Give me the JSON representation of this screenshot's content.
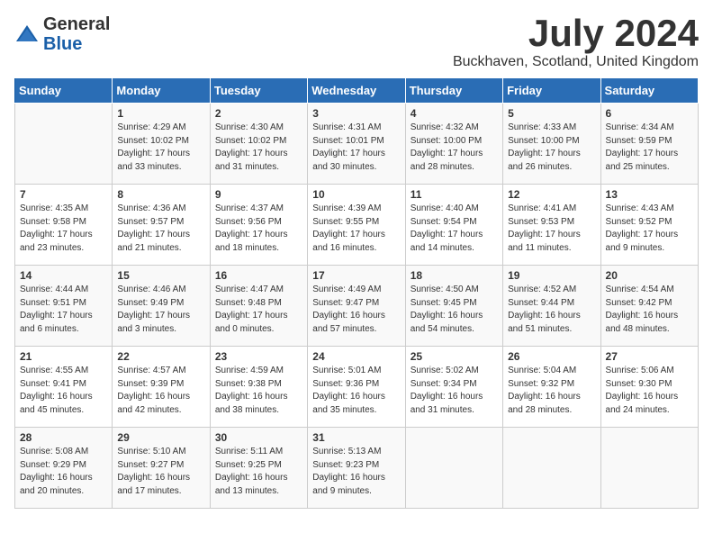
{
  "header": {
    "logo_line1": "General",
    "logo_line2": "Blue",
    "month": "July 2024",
    "location": "Buckhaven, Scotland, United Kingdom"
  },
  "days_of_week": [
    "Sunday",
    "Monday",
    "Tuesday",
    "Wednesday",
    "Thursday",
    "Friday",
    "Saturday"
  ],
  "weeks": [
    [
      {
        "day": "",
        "content": ""
      },
      {
        "day": "1",
        "content": "Sunrise: 4:29 AM\nSunset: 10:02 PM\nDaylight: 17 hours\nand 33 minutes."
      },
      {
        "day": "2",
        "content": "Sunrise: 4:30 AM\nSunset: 10:02 PM\nDaylight: 17 hours\nand 31 minutes."
      },
      {
        "day": "3",
        "content": "Sunrise: 4:31 AM\nSunset: 10:01 PM\nDaylight: 17 hours\nand 30 minutes."
      },
      {
        "day": "4",
        "content": "Sunrise: 4:32 AM\nSunset: 10:00 PM\nDaylight: 17 hours\nand 28 minutes."
      },
      {
        "day": "5",
        "content": "Sunrise: 4:33 AM\nSunset: 10:00 PM\nDaylight: 17 hours\nand 26 minutes."
      },
      {
        "day": "6",
        "content": "Sunrise: 4:34 AM\nSunset: 9:59 PM\nDaylight: 17 hours\nand 25 minutes."
      }
    ],
    [
      {
        "day": "7",
        "content": "Sunrise: 4:35 AM\nSunset: 9:58 PM\nDaylight: 17 hours\nand 23 minutes."
      },
      {
        "day": "8",
        "content": "Sunrise: 4:36 AM\nSunset: 9:57 PM\nDaylight: 17 hours\nand 21 minutes."
      },
      {
        "day": "9",
        "content": "Sunrise: 4:37 AM\nSunset: 9:56 PM\nDaylight: 17 hours\nand 18 minutes."
      },
      {
        "day": "10",
        "content": "Sunrise: 4:39 AM\nSunset: 9:55 PM\nDaylight: 17 hours\nand 16 minutes."
      },
      {
        "day": "11",
        "content": "Sunrise: 4:40 AM\nSunset: 9:54 PM\nDaylight: 17 hours\nand 14 minutes."
      },
      {
        "day": "12",
        "content": "Sunrise: 4:41 AM\nSunset: 9:53 PM\nDaylight: 17 hours\nand 11 minutes."
      },
      {
        "day": "13",
        "content": "Sunrise: 4:43 AM\nSunset: 9:52 PM\nDaylight: 17 hours\nand 9 minutes."
      }
    ],
    [
      {
        "day": "14",
        "content": "Sunrise: 4:44 AM\nSunset: 9:51 PM\nDaylight: 17 hours\nand 6 minutes."
      },
      {
        "day": "15",
        "content": "Sunrise: 4:46 AM\nSunset: 9:49 PM\nDaylight: 17 hours\nand 3 minutes."
      },
      {
        "day": "16",
        "content": "Sunrise: 4:47 AM\nSunset: 9:48 PM\nDaylight: 17 hours\nand 0 minutes."
      },
      {
        "day": "17",
        "content": "Sunrise: 4:49 AM\nSunset: 9:47 PM\nDaylight: 16 hours\nand 57 minutes."
      },
      {
        "day": "18",
        "content": "Sunrise: 4:50 AM\nSunset: 9:45 PM\nDaylight: 16 hours\nand 54 minutes."
      },
      {
        "day": "19",
        "content": "Sunrise: 4:52 AM\nSunset: 9:44 PM\nDaylight: 16 hours\nand 51 minutes."
      },
      {
        "day": "20",
        "content": "Sunrise: 4:54 AM\nSunset: 9:42 PM\nDaylight: 16 hours\nand 48 minutes."
      }
    ],
    [
      {
        "day": "21",
        "content": "Sunrise: 4:55 AM\nSunset: 9:41 PM\nDaylight: 16 hours\nand 45 minutes."
      },
      {
        "day": "22",
        "content": "Sunrise: 4:57 AM\nSunset: 9:39 PM\nDaylight: 16 hours\nand 42 minutes."
      },
      {
        "day": "23",
        "content": "Sunrise: 4:59 AM\nSunset: 9:38 PM\nDaylight: 16 hours\nand 38 minutes."
      },
      {
        "day": "24",
        "content": "Sunrise: 5:01 AM\nSunset: 9:36 PM\nDaylight: 16 hours\nand 35 minutes."
      },
      {
        "day": "25",
        "content": "Sunrise: 5:02 AM\nSunset: 9:34 PM\nDaylight: 16 hours\nand 31 minutes."
      },
      {
        "day": "26",
        "content": "Sunrise: 5:04 AM\nSunset: 9:32 PM\nDaylight: 16 hours\nand 28 minutes."
      },
      {
        "day": "27",
        "content": "Sunrise: 5:06 AM\nSunset: 9:30 PM\nDaylight: 16 hours\nand 24 minutes."
      }
    ],
    [
      {
        "day": "28",
        "content": "Sunrise: 5:08 AM\nSunset: 9:29 PM\nDaylight: 16 hours\nand 20 minutes."
      },
      {
        "day": "29",
        "content": "Sunrise: 5:10 AM\nSunset: 9:27 PM\nDaylight: 16 hours\nand 17 minutes."
      },
      {
        "day": "30",
        "content": "Sunrise: 5:11 AM\nSunset: 9:25 PM\nDaylight: 16 hours\nand 13 minutes."
      },
      {
        "day": "31",
        "content": "Sunrise: 5:13 AM\nSunset: 9:23 PM\nDaylight: 16 hours\nand 9 minutes."
      },
      {
        "day": "",
        "content": ""
      },
      {
        "day": "",
        "content": ""
      },
      {
        "day": "",
        "content": ""
      }
    ]
  ]
}
